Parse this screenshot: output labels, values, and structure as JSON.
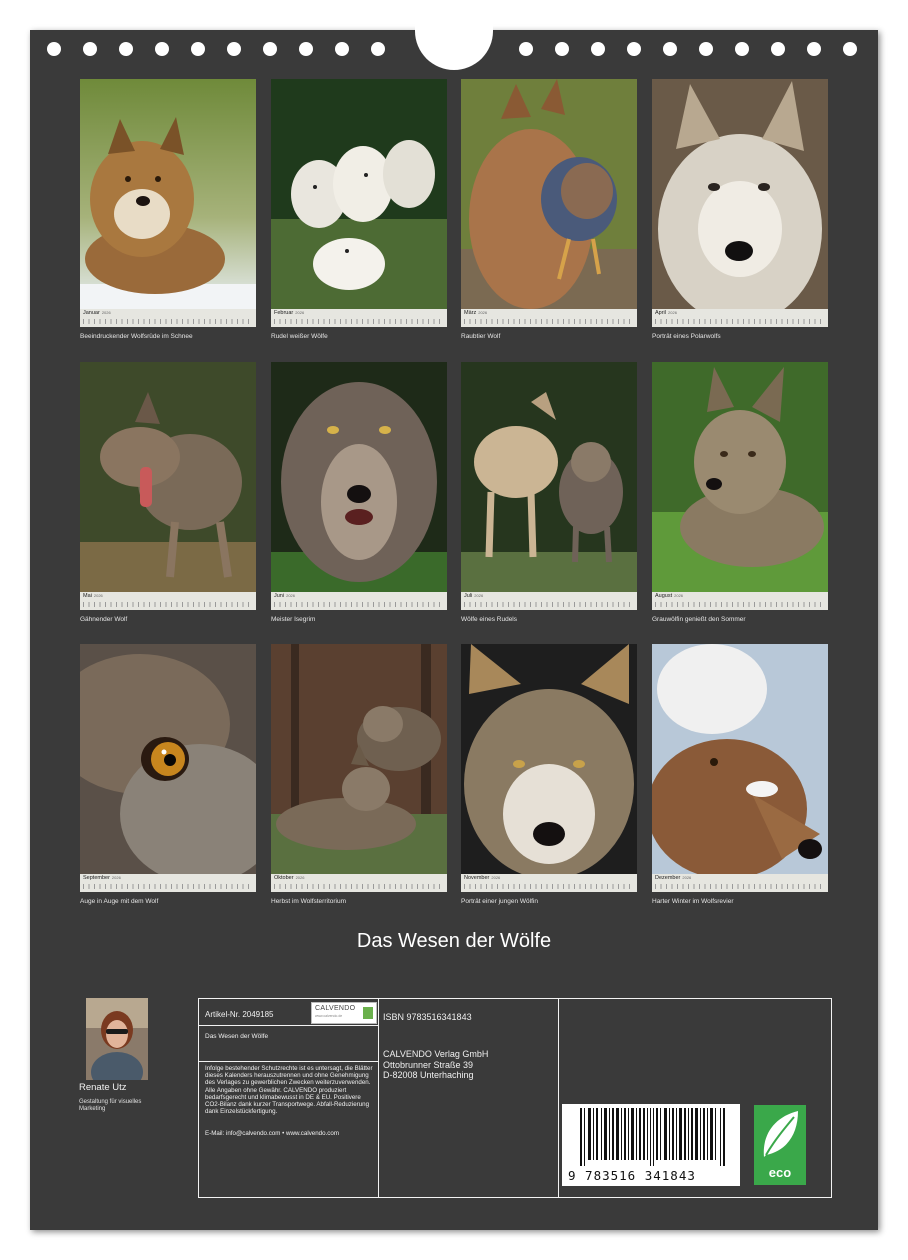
{
  "calendar": {
    "title": "Das Wesen der Wölfe",
    "year": "2026",
    "months": [
      {
        "month": "Januar",
        "caption": "Beeindruckender Wolfsrüde im Schnee"
      },
      {
        "month": "Februar",
        "caption": "Rudel weißer Wölfe"
      },
      {
        "month": "März",
        "caption": "Raubtier Wolf"
      },
      {
        "month": "April",
        "caption": "Porträt eines Polarwolfs"
      },
      {
        "month": "Mai",
        "caption": "Gähnender Wolf"
      },
      {
        "month": "Juni",
        "caption": "Meister Isegrim"
      },
      {
        "month": "Juli",
        "caption": "Wölfe eines Rudels"
      },
      {
        "month": "August",
        "caption": "Grauwölfin genießt den Sommer"
      },
      {
        "month": "September",
        "caption": "Auge in Auge mit dem Wolf"
      },
      {
        "month": "Oktober",
        "caption": "Herbst im Wolfsterritorium"
      },
      {
        "month": "November",
        "caption": "Porträt einer jungen Wölfin"
      },
      {
        "month": "Dezember",
        "caption": "Harter Winter im Wolfsrevier"
      }
    ]
  },
  "author": {
    "name": "Renate Utz",
    "role": "Gestaltung für visuelles Marketing"
  },
  "info": {
    "article": "Artikel-Nr. 2049185",
    "logo_text": "CALVENDO",
    "logo_subtext": "www.calvendo.de",
    "product_title": "Das Wesen der Wölfe",
    "legal": "Infolge bestehender Schutzrechte ist es untersagt, die Blätter dieses Kalenders herauszutrennen und ohne Genehmigung des Verlages zu gewerblichen Zwecken weiterzuverwenden. Alle Angaben ohne Gewähr. CALVENDO produziert bedarfsgerecht und klimabewusst in DE & EU. Positivere CO2-Bilanz dank kurzer Transportwege. Abfall-Reduzierung dank Einzelstückfertigung.",
    "contact": "E-Mail: info@calvendo.com • www.calvendo.com",
    "isbn": "ISBN 9783516341843",
    "publisher": [
      "CALVENDO Verlag GmbH",
      "Ottobrunner Straße 39",
      "D-82008 Unterhaching"
    ],
    "barcode_number": "9 783516 341843",
    "eco_label": "eco"
  },
  "colors": {
    "sheet": "#3a3a3a",
    "text": "#f0f0f0",
    "eco_green": "#3aa84a"
  }
}
